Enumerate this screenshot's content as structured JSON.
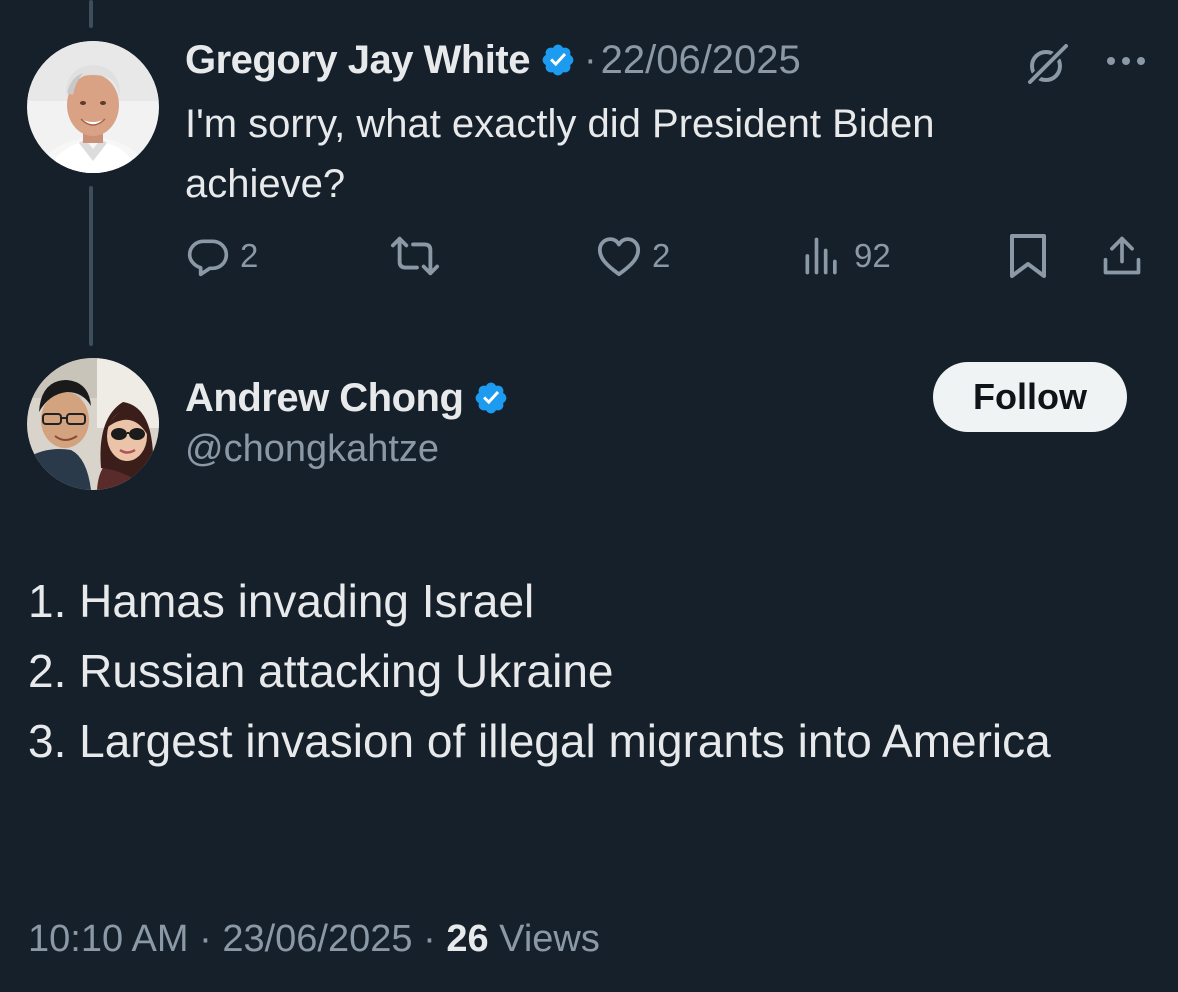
{
  "tweet1": {
    "author": "Gregory Jay White",
    "separator": "·",
    "date": "22/06/2025",
    "text": "I'm sorry, what exactly did President Biden achieve?",
    "actions": {
      "replies": "2",
      "likes": "2",
      "views": "92"
    }
  },
  "tweet2": {
    "author": "Andrew Chong",
    "handle": "@chongkahtze",
    "follow_label": "Follow",
    "lines": [
      "1. Hamas invading Israel",
      "2. Russian attacking Ukraine",
      "3. Largest invasion of illegal migrants into America"
    ],
    "time": "10:10 AM",
    "sep1": "·",
    "date": "23/06/2025",
    "sep2": "·",
    "views_count": "26",
    "views_label": "Views"
  },
  "colors": {
    "background": "#15202b",
    "text_primary": "#e7e9ea",
    "text_secondary": "#8b98a5",
    "verified_badge": "#1d9bf0",
    "thread_line": "#3e4e5d",
    "follow_button_bg": "#eff3f4"
  },
  "icons": {
    "verified": "verified-badge-icon",
    "grok": "grok-icon",
    "more": "more-options-icon",
    "reply": "reply-icon",
    "retweet": "retweet-icon",
    "like": "heart-icon",
    "views": "views-chart-icon",
    "bookmark": "bookmark-icon",
    "share": "share-icon"
  }
}
